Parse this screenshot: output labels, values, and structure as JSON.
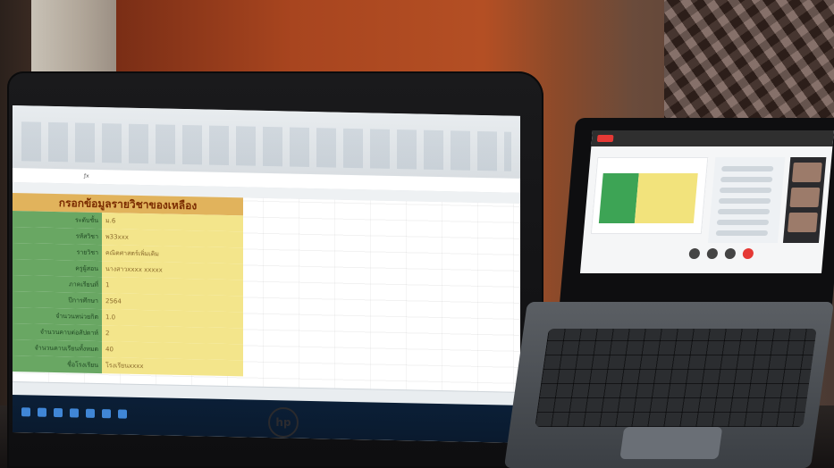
{
  "scene": {
    "laptop_left": {
      "brand_logo_text": "hp",
      "excel": {
        "form_title": "กรอกข้อมูลรายวิชาของเหลือง",
        "fields": [
          {
            "label": "ระดับชั้น",
            "value": "ม.6"
          },
          {
            "label": "รหัสวิชา",
            "value": "พ33xxx"
          },
          {
            "label": "รายวิชา",
            "value": "คณิตศาสตร์เพิ่มเติม"
          },
          {
            "label": "ครูผู้สอน",
            "value": "นางสาวxxxx xxxxx"
          },
          {
            "label": "ภาคเรียนที่",
            "value": "1"
          },
          {
            "label": "ปีการศึกษา",
            "value": "2564"
          },
          {
            "label": "จำนวนหน่วยกิต",
            "value": "1.0"
          },
          {
            "label": "จำนวนคาบต่อสัปดาห์",
            "value": "2"
          },
          {
            "label": "จำนวนคาบเรียนทั้งหมด",
            "value": "40"
          },
          {
            "label": "ชื่อโรงเรียน",
            "value": "โรงเรียนxxxx"
          }
        ]
      }
    },
    "laptop_right": {
      "meeting": {
        "panel_lines_count": 8
      }
    }
  }
}
